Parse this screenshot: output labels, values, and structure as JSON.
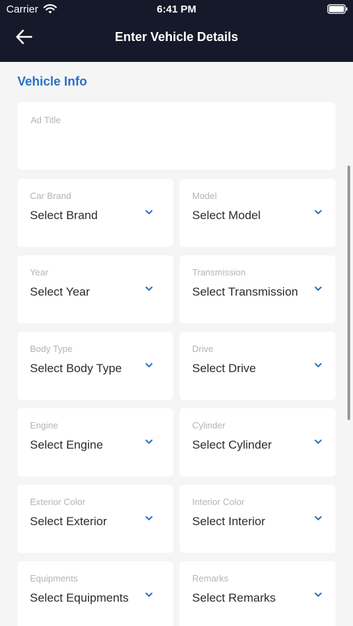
{
  "status_bar": {
    "carrier": "Carrier",
    "time": "6:41 PM"
  },
  "nav": {
    "title": "Enter Vehicle Details"
  },
  "section": {
    "title": "Vehicle Info"
  },
  "form": {
    "ad_title": {
      "label": "Ad Title",
      "value": ""
    },
    "car_brand": {
      "label": "Car Brand",
      "value": "Select Brand"
    },
    "model": {
      "label": "Model",
      "value": "Select Model"
    },
    "year": {
      "label": "Year",
      "value": "Select Year"
    },
    "transmission": {
      "label": "Transmission",
      "value": "Select Transmission"
    },
    "body_type": {
      "label": "Body Type",
      "value": "Select Body Type"
    },
    "drive": {
      "label": "Drive",
      "value": "Select Drive"
    },
    "engine": {
      "label": "Engine",
      "value": "Select Engine"
    },
    "cylinder": {
      "label": "Cylinder",
      "value": "Select Cylinder"
    },
    "exterior_color": {
      "label": "Exterior Color",
      "value": "Select Exterior"
    },
    "interior_color": {
      "label": "Interior Color",
      "value": "Select Interior"
    },
    "equipments": {
      "label": "Equipments",
      "value": "Select Equipments"
    },
    "remarks": {
      "label": "Remarks",
      "value": "Select Remarks"
    }
  },
  "icons": {
    "back": "back-arrow-icon",
    "dropdown": "chevron-down-icon",
    "wifi": "wifi-icon",
    "battery": "battery-icon"
  },
  "colors": {
    "header_bg": "#16192a",
    "accent": "#2a71c4",
    "page_bg": "#f5f5f6"
  }
}
